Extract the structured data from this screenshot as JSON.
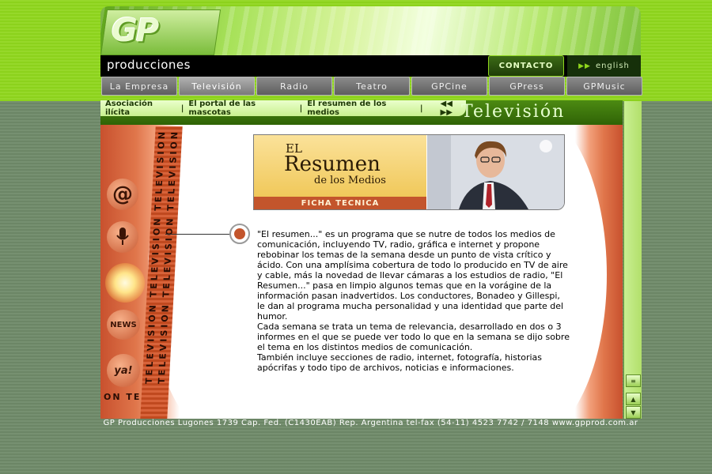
{
  "brand": {
    "logo": "GP",
    "tagline": "producciones"
  },
  "header": {
    "contact_label": "CONTACTO",
    "language_label": "english"
  },
  "nav": {
    "items": [
      {
        "label": "La Empresa"
      },
      {
        "label": "Televisión"
      },
      {
        "label": "Radio"
      },
      {
        "label": "Teatro"
      },
      {
        "label": "GPCine"
      },
      {
        "label": "GPress"
      },
      {
        "label": "GPMusic"
      }
    ],
    "active_index": 1
  },
  "subnav": {
    "items": [
      {
        "label": "Asociación ilícita"
      },
      {
        "label": "El portal de las mascotas"
      },
      {
        "label": "El resumen de los medios"
      }
    ],
    "separator": "|",
    "prev_next": "◀◀ ▶▶"
  },
  "section": {
    "title": "Televisión"
  },
  "side": {
    "strip_text": "TELEVISION TELEVISION TELEVISION",
    "icons": [
      {
        "name": "at-icon",
        "glyph": "@"
      },
      {
        "name": "microphone-icon",
        "glyph": "🎙"
      },
      {
        "name": "light-icon",
        "glyph": ""
      },
      {
        "name": "news-icon",
        "glyph": "NEWS"
      },
      {
        "name": "ya-icon",
        "glyph": "ya!"
      }
    ],
    "on_tv_text": "ON TE"
  },
  "card": {
    "el": "EL",
    "title": "Resumen",
    "subtitle": "de los Medios",
    "ficha": "FICHA TECNICA"
  },
  "content": {
    "paragraphs": [
      "\"El resumen...\" es un programa que se nutre de todos los medios de comunicación, incluyendo TV, radio, gráfica e internet y propone rebobinar los temas de la semana desde un punto de vista crítico y ácido. Con una amplísima cobertura de todo lo producido en TV de aire y cable, más la novedad de llevar cámaras a los estudios de radio, \"El Resumen...\" pasa en limpio algunos temas que en la vorágine de la información pasan inadvertidos. Los conductores, Bonadeo y Gillespi, le dan al programa mucha personalidad y una identidad que parte del humor.",
      "Cada semana se trata un tema de relevancia, desarrollado en dos o 3 informes en el que se puede ver todo lo que en la semana se dijo sobre el tema en los distintos medios de comunicación.",
      "También incluye secciones de radio, internet, fotografía, historias apócrifas y todo tipo de archivos, noticias e informaciones."
    ]
  },
  "footer": {
    "text": "GP Producciones Lugones 1739 Cap. Fed. (C1430EAB) Rep. Argentina tel-fax (54-11) 4523 7742 / 7148 www.gpprod.com.ar"
  },
  "colors": {
    "lime": "#8fd61d",
    "sage": "#6f8a69",
    "orange": "#c3552c",
    "dark_green": "#2f6306"
  }
}
